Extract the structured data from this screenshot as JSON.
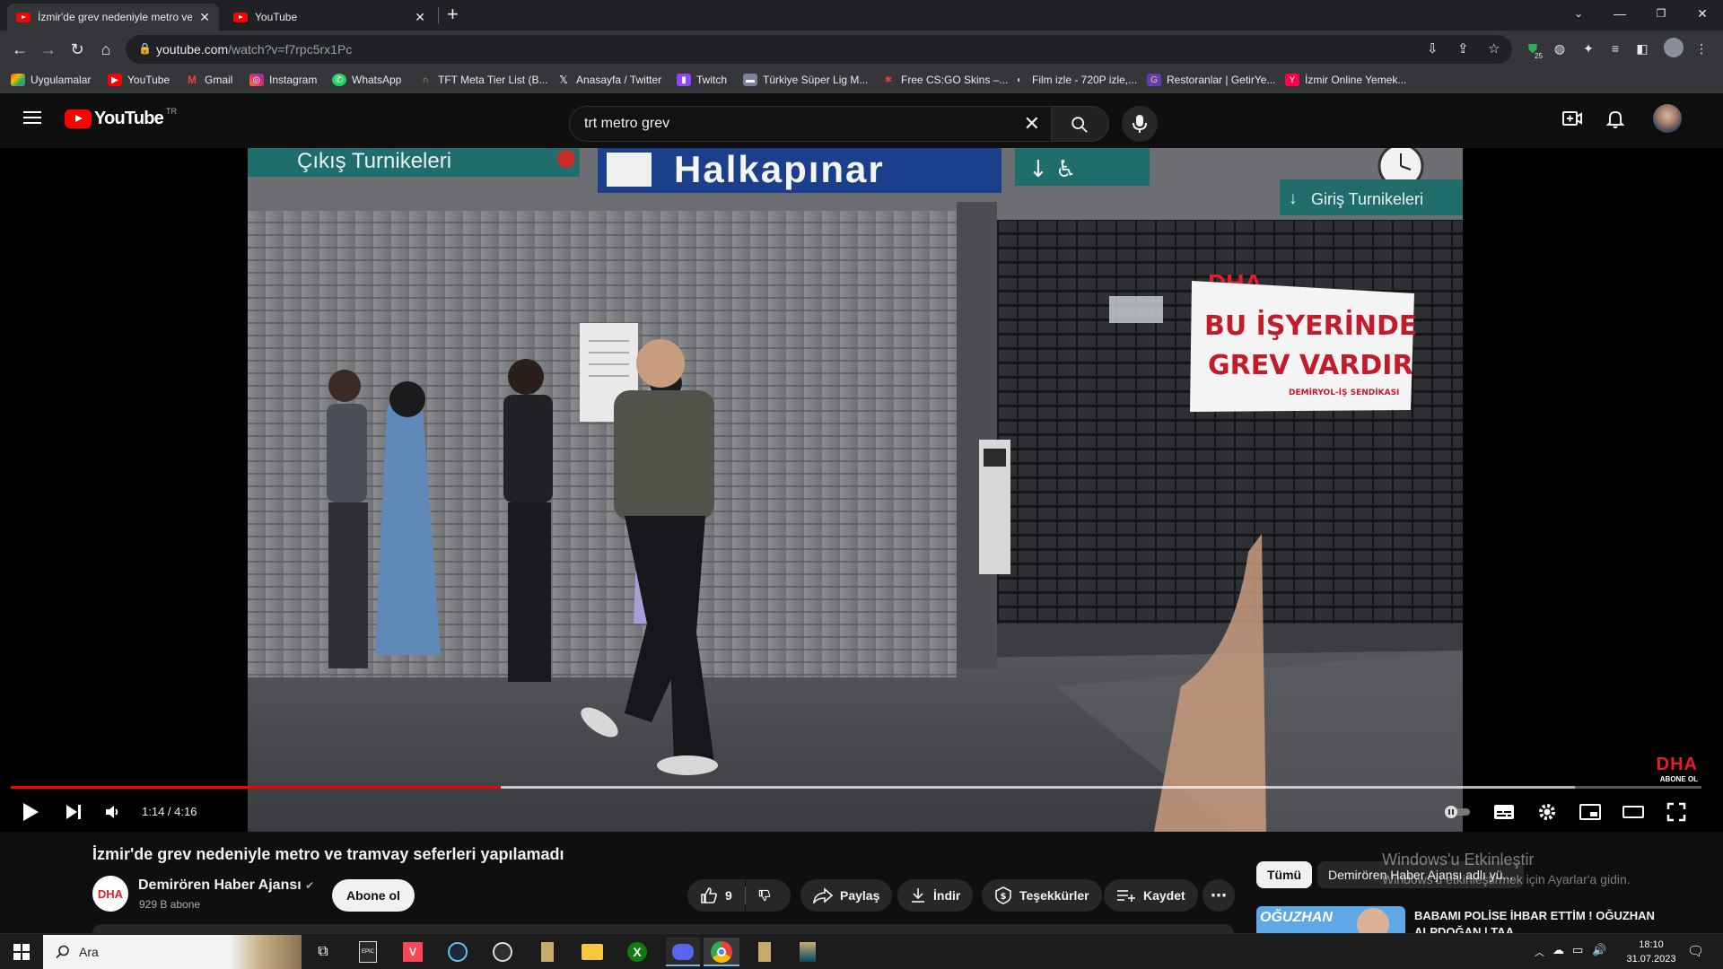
{
  "browser": {
    "tabs": [
      {
        "title": "İzmir'de grev nedeniyle metro ve",
        "active": true
      },
      {
        "title": "YouTube",
        "active": false
      }
    ],
    "url_host": "youtube.com",
    "url_path": "/watch?v=f7rpc5rx1Pc",
    "extension_badge": "25"
  },
  "bookmarks": [
    {
      "label": "Uygulamalar",
      "icon": "apps-grid-icon"
    },
    {
      "label": "YouTube",
      "icon": "youtube-icon"
    },
    {
      "label": "Gmail",
      "icon": "gmail-icon"
    },
    {
      "label": "Instagram",
      "icon": "instagram-icon"
    },
    {
      "label": "WhatsApp",
      "icon": "whatsapp-icon"
    },
    {
      "label": "TFT Meta Tier List (B...",
      "icon": "tft-icon"
    },
    {
      "label": "Anasayfa / Twitter",
      "icon": "x-icon"
    },
    {
      "label": "Twitch",
      "icon": "twitch-icon"
    },
    {
      "label": "Türkiye Süper Lig M...",
      "icon": "league-icon"
    },
    {
      "label": "Free CS:GO Skins –...",
      "icon": "csgo-icon"
    },
    {
      "label": "Film izle - 720P izle,...",
      "icon": "film-icon"
    },
    {
      "label": "Restoranlar | GetirYe...",
      "icon": "getir-icon"
    },
    {
      "label": "İzmir Online Yemek...",
      "icon": "yemek-icon"
    }
  ],
  "youtube": {
    "logo_text": "YouTube",
    "country_code": "TR",
    "search_value": "trt metro grev",
    "colors": {
      "brand": "#ff0000",
      "bg": "#0f0f0f"
    }
  },
  "player": {
    "current_time": "1:14",
    "duration": "4:16",
    "time_separator": " / ",
    "played_fraction": 0.29,
    "loaded_fraction": 0.925,
    "corner_logo": "DHA",
    "corner_subscribe": "ABONE OL",
    "scene_text": {
      "sign_exit": "Çıkış Turnikeleri",
      "sign_station": "Halkapınar",
      "sign_entry": "Giriş Turnikeleri",
      "banner_brand": "DHA",
      "banner_line1": "BU İŞYERİNDE",
      "banner_line2": "GREV VARDIR",
      "banner_union": "DEMİRYOL-İŞ SENDİKASI"
    }
  },
  "video": {
    "title": "İzmir'de grev nedeniyle metro ve tramvay seferleri yapılamadı",
    "channel": "Demirören Haber Ajansı",
    "subscribers": "929 B abone",
    "subscribe_label": "Abone ol",
    "like_count": "9",
    "share_label": "Paylaş",
    "download_label": "İndir",
    "thanks_label": "Teşekkürler",
    "save_label": "Kaydet"
  },
  "recommendations": {
    "chips": [
      "Tümü",
      "Demirören Haber Ajansı adlı yü..."
    ],
    "first_title": "BABAMI POLİSE İHBAR ETTİM ! OĞUZHAN ALPDOĞAN | TAA...",
    "first_thumb_text": "OĞUZHAN"
  },
  "watermark": {
    "line1": "Windows'u Etkinleştir",
    "line2": "Windows'u etkinleştirmek için Ayarlar'a gidin."
  },
  "taskbar": {
    "search_placeholder": "Ara",
    "time": "18:10",
    "date": "31.07.2023",
    "apps": [
      "task-view-icon",
      "epic-games-icon",
      "valorant-icon",
      "steam-icon",
      "obs-icon",
      "league-client-icon",
      "file-explorer-icon",
      "xbox-icon",
      "discord-icon",
      "chrome-icon",
      "league-icon",
      "lol-icon"
    ]
  }
}
